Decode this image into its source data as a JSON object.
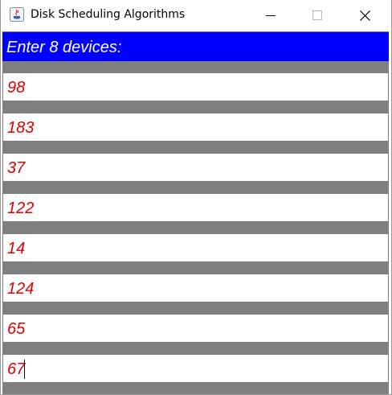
{
  "window": {
    "title": "Disk Scheduling Algorithms",
    "controls": [
      "minimize-icon",
      "maximize-icon",
      "close-icon"
    ]
  },
  "header": {
    "label": "Enter 8 devices:",
    "color": "#0000ff"
  },
  "fields": [
    {
      "value": "98"
    },
    {
      "value": "183"
    },
    {
      "value": "37"
    },
    {
      "value": "122"
    },
    {
      "value": "14"
    },
    {
      "value": "124"
    },
    {
      "value": "65"
    },
    {
      "value": "67"
    }
  ],
  "colors": {
    "field_text": "#e00000",
    "gap": "#808080",
    "header_text": "#ffffff"
  }
}
